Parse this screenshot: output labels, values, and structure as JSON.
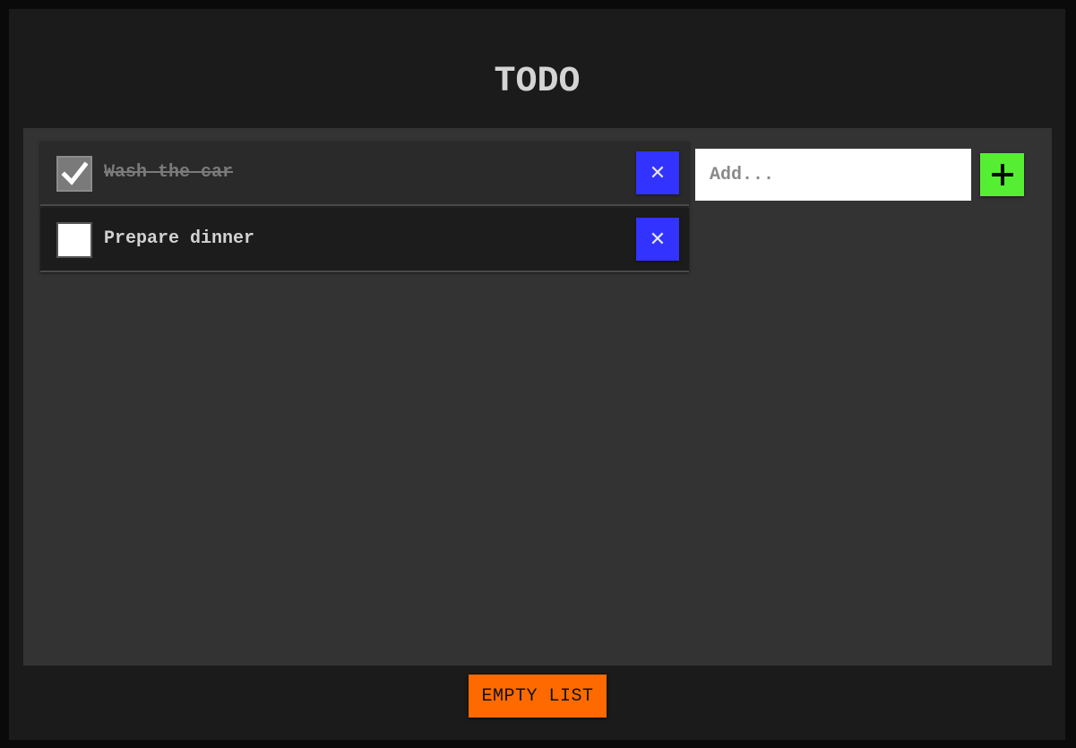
{
  "header": {
    "title": "TODO"
  },
  "todos": [
    {
      "text": "Wash the car",
      "done": true,
      "delete_icon": "close-icon"
    },
    {
      "text": "Prepare dinner",
      "done": false,
      "delete_icon": "close-icon"
    }
  ],
  "add_form": {
    "placeholder": "Add...",
    "value": "",
    "button_icon": "plus-icon"
  },
  "footer": {
    "empty_label": "EMPTY LIST"
  },
  "colors": {
    "background": "#1b1b1b",
    "panel": "#333333",
    "delete_button": "#3333ff",
    "add_button": "#55ee33",
    "empty_button": "#ff6a00"
  }
}
